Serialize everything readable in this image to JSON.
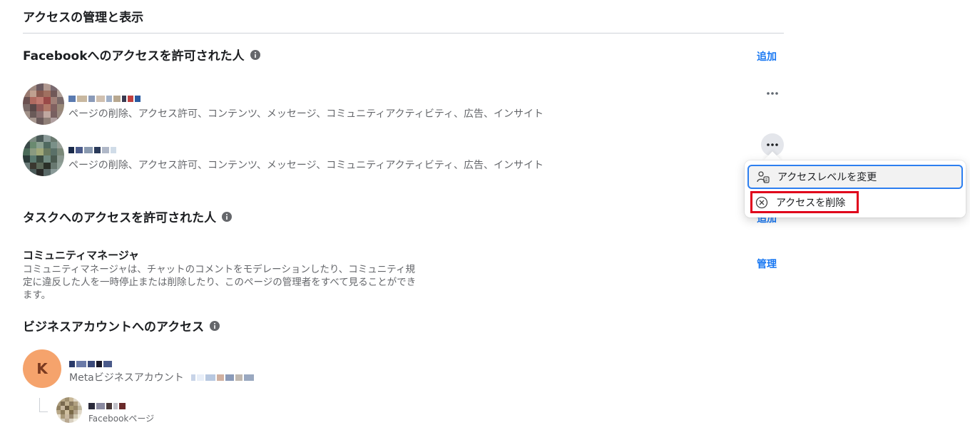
{
  "page": {
    "title": "アクセスの管理と表示"
  },
  "facebook_access": {
    "title": "Facebookへのアクセスを許可された人",
    "add_label": "追加",
    "people": [
      {
        "permissions": "ページの削除、アクセス許可、コンテンツ、メッセージ、コミュニティアクティビティ、広告、インサイト"
      },
      {
        "permissions": "ページの削除、アクセス許可、コンテンツ、メッセージ、コミュニティアクティビティ、広告、インサイト"
      }
    ]
  },
  "context_menu": {
    "items": [
      {
        "label": "アクセスレベルを変更",
        "icon": "person-settings-icon"
      },
      {
        "label": "アクセスを削除",
        "icon": "circle-x-icon"
      }
    ]
  },
  "task_access": {
    "title": "タスクへのアクセスを許可された人",
    "add_label": "追加",
    "community_manager": {
      "title": "コミュニティマネージャ",
      "description": "コミュニティマネージャは、チャットのコメントをモデレーションしたり、コミュニティ規定に違反した人を一時停止または削除したり、このページの管理者をすべて見ることができます。",
      "manage_label": "管理"
    }
  },
  "business_access": {
    "title": "ビジネスアカウントへのアクセス",
    "account": {
      "avatar_letter": "K",
      "subtitle": "Metaビジネスアカウント"
    },
    "page": {
      "subtitle": "Facebookページ"
    }
  },
  "colors": {
    "link": "#1877f2",
    "highlight": "#e0001b",
    "focus": "#2d7ff0"
  }
}
